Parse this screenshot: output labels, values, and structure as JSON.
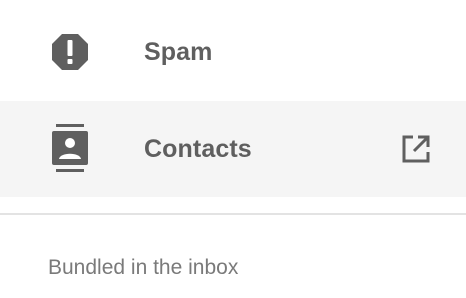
{
  "nav": {
    "items": [
      {
        "label": "Spam",
        "icon": "spam-octagon-icon"
      },
      {
        "label": "Contacts",
        "icon": "contacts-icon",
        "trailing_icon": "open-in-new-icon"
      }
    ]
  },
  "section": {
    "label": "Bundled in the inbox"
  },
  "colors": {
    "icon": "#5f5f5f",
    "label": "#5f5f5f",
    "selected_bg": "#f5f5f5",
    "divider": "#e3e3e3",
    "section_label": "#7a7a7a"
  }
}
